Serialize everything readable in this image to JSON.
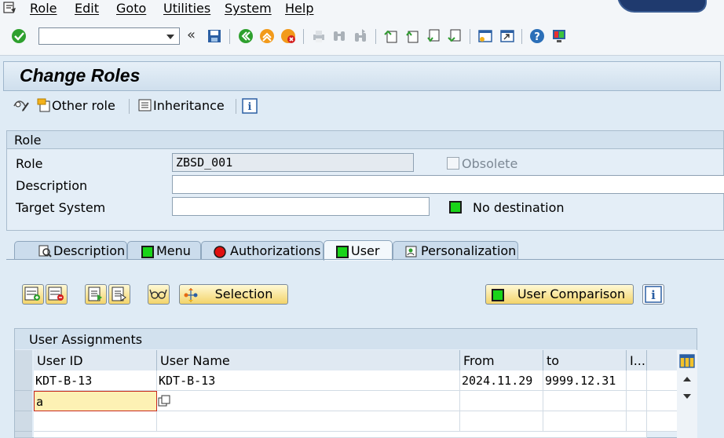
{
  "menubar": {
    "items": [
      "Role",
      "Edit",
      "Goto",
      "Utilities",
      "System",
      "Help"
    ]
  },
  "toolbar": {
    "command_field_value": "",
    "icons": [
      "enter-icon",
      "back-icon",
      "save-icon",
      "back-nav-icon",
      "exit-icon",
      "cancel-icon",
      "print-icon",
      "find-icon",
      "find-next-icon",
      "first-page-icon",
      "prev-page-icon",
      "next-page-icon",
      "last-page-icon",
      "new-session-icon",
      "shortcut-icon",
      "help-icon",
      "customize-layout-icon"
    ]
  },
  "title": "Change Roles",
  "app_toolbar": {
    "other_role": "Other role",
    "inheritance": "Inheritance"
  },
  "role_section": {
    "header": "Role",
    "role_label": "Role",
    "role_value": "ZBSD_001",
    "obsolete_label": "Obsolete",
    "description_label": "Description",
    "description_value": "",
    "target_system_label": "Target System",
    "target_system_value": "",
    "destination_status": "No destination"
  },
  "tabs": [
    {
      "label": "Description",
      "icon": "description-icon"
    },
    {
      "label": "Menu",
      "icon": "green-status-icon"
    },
    {
      "label": "Authorizations",
      "icon": "red-status-icon"
    },
    {
      "label": "User",
      "icon": "green-status-icon",
      "active": true
    },
    {
      "label": "Personalization",
      "icon": "personalization-icon"
    }
  ],
  "user_tab": {
    "selection_button": "Selection",
    "user_comparison_button": "User Comparison",
    "assignments_header": "User Assignments",
    "columns": [
      "User ID",
      "User Name",
      "From",
      "to",
      "I..."
    ],
    "rows": [
      {
        "user_id": "KDT-B-13",
        "user_name": "KDT-B-13",
        "from": "2024.11.29",
        "to": "9999.12.31"
      },
      {
        "user_id": "a",
        "user_name": "",
        "from": "",
        "to": ""
      },
      {
        "user_id": "",
        "user_name": "",
        "from": "",
        "to": ""
      }
    ]
  },
  "colors": {
    "background": "#dfebf5",
    "status_green": "#19d419",
    "status_red": "#e01010",
    "button_yellow": "#f3d46a",
    "input_highlight": "#fdf1b4"
  }
}
